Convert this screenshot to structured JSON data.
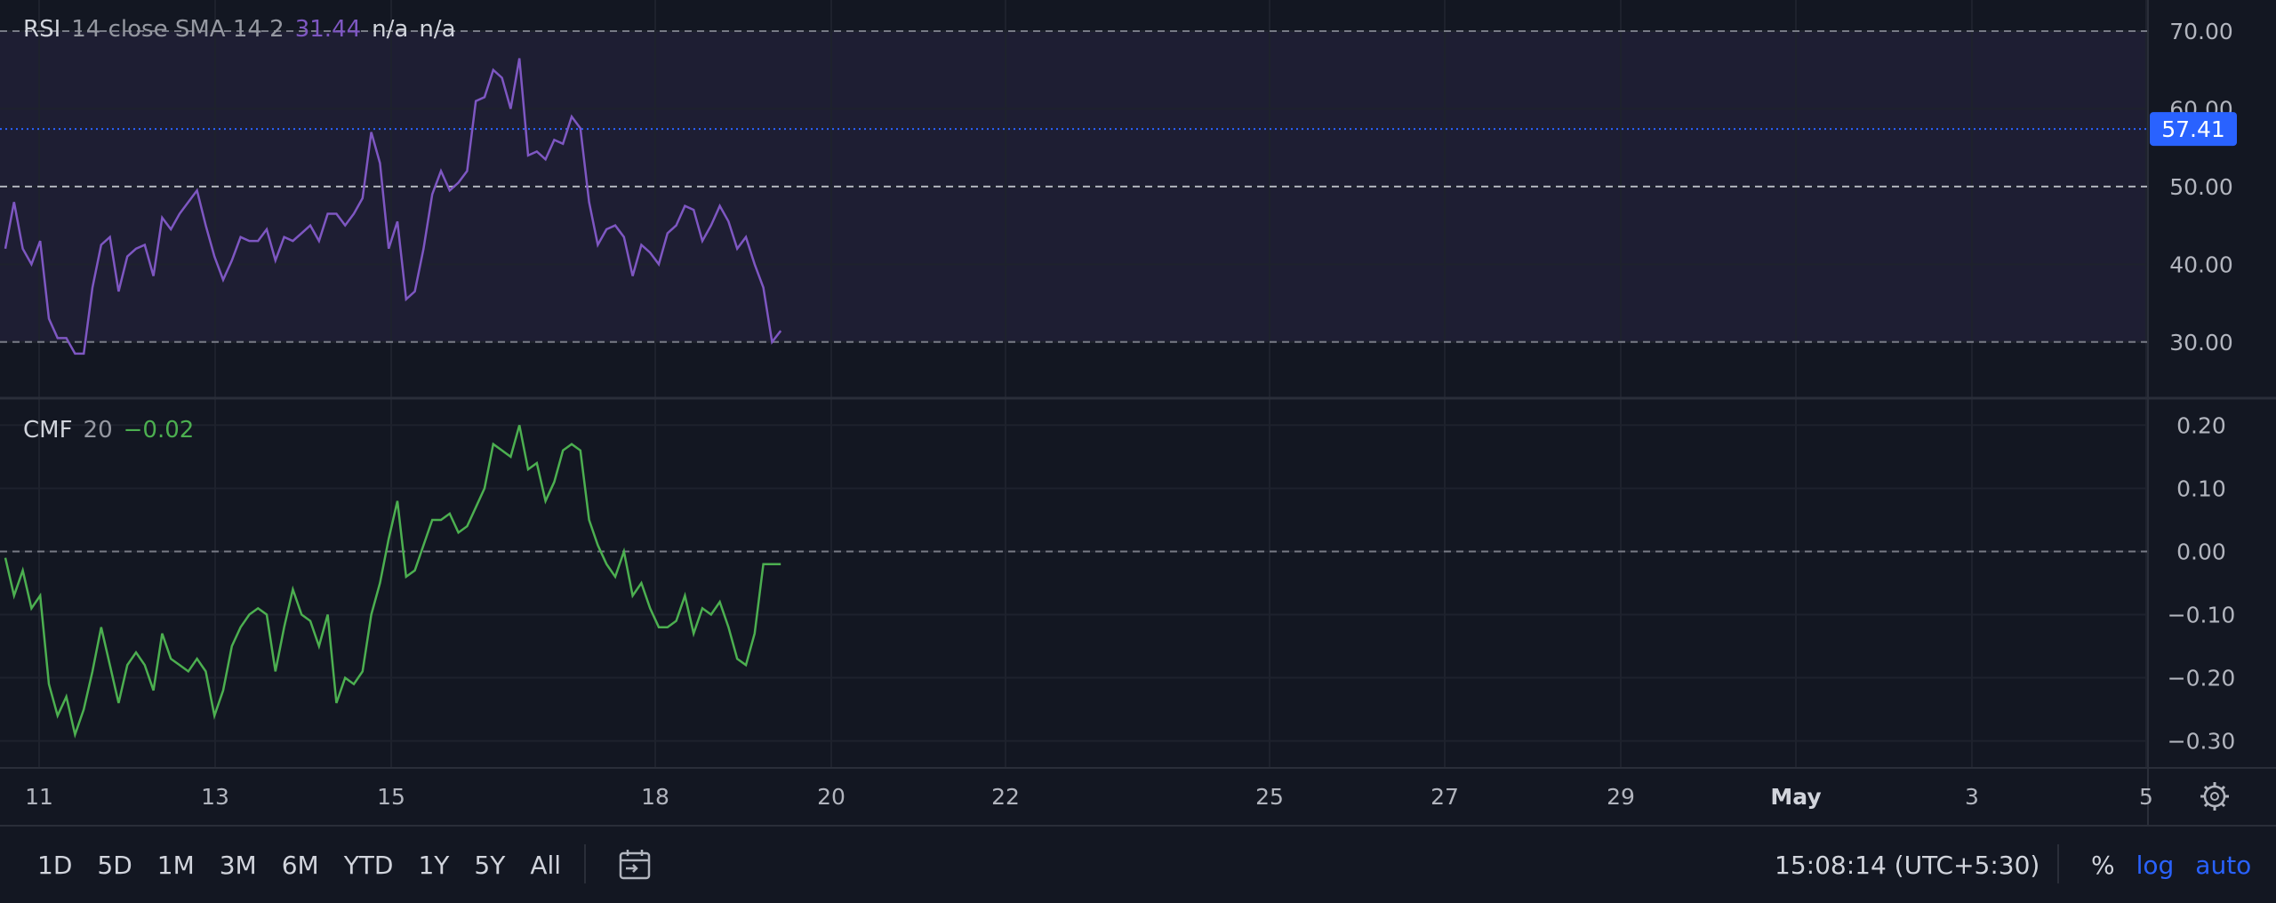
{
  "rsi_legend": {
    "name": "RSI",
    "params": "14 close SMA 14 2",
    "value": "31.44",
    "na1": "n/a",
    "na2": "n/a"
  },
  "cmf_legend": {
    "name": "CMF",
    "params": "20",
    "value": "−0.02"
  },
  "toolbar": {
    "ranges": [
      "1D",
      "5D",
      "1M",
      "3M",
      "6M",
      "YTD",
      "1Y",
      "5Y",
      "All"
    ],
    "time": "15:08:14 (UTC+5:30)",
    "percent": "%",
    "log": "log",
    "auto": "auto"
  },
  "colors": {
    "rsi_line": "#7e57c2",
    "cmf_line": "#4caf50",
    "price_badge": "#2962ff",
    "accent_text": "#2962ff"
  },
  "icons": [
    "calendar-range-icon",
    "settings-gear-icon"
  ],
  "chart_data": [
    {
      "type": "line",
      "name": "RSI",
      "x_ticks": [
        "11",
        "13",
        "15",
        "18",
        "20",
        "22",
        "25",
        "27",
        "29",
        "May",
        "3",
        "5"
      ],
      "y_ticks": [
        "70.00",
        "60.00",
        "50.00",
        "40.00",
        "30.00"
      ],
      "ylim": [
        23,
        74
      ],
      "bands": {
        "upper": 70,
        "middle": 50,
        "lower": 30
      },
      "crosshair_value": 57.41,
      "crosshair_label": "57.41",
      "x": [
        0,
        1,
        2,
        3,
        4,
        5,
        6,
        7,
        8,
        9,
        10,
        11,
        12,
        13,
        14,
        15,
        16,
        17,
        18,
        19,
        20,
        21,
        22,
        23,
        24,
        25,
        26,
        27,
        28,
        29,
        30,
        31,
        32,
        33,
        34,
        35,
        36,
        37,
        38,
        39,
        40,
        41,
        42,
        43,
        44,
        45,
        46,
        47,
        48,
        49,
        50,
        51,
        52,
        53,
        54,
        55,
        56,
        57,
        58,
        59,
        60,
        61,
        62,
        63,
        64,
        65,
        66,
        67,
        68,
        69,
        70,
        71,
        72,
        73,
        74,
        75,
        76,
        77,
        78,
        79,
        80,
        81,
        82,
        83,
        84,
        85,
        86,
        87,
        88,
        89,
        90,
        91,
        92,
        93,
        94,
        95,
        96,
        97,
        98,
        99,
        100,
        101,
        102,
        103,
        104,
        105,
        106,
        107,
        108,
        109,
        110,
        111,
        112,
        113,
        114,
        115,
        116,
        117,
        118,
        119,
        120,
        121,
        122,
        123,
        124,
        125,
        126,
        127,
        128,
        129,
        130,
        131,
        132,
        133,
        134,
        135,
        136,
        137,
        138,
        139,
        140,
        141,
        142,
        143,
        144,
        145,
        146,
        147,
        148
      ],
      "values": [
        42,
        48,
        42,
        40,
        43,
        33,
        30.5,
        30.5,
        28.5,
        28.5,
        37,
        42.5,
        43.5,
        36.5,
        41,
        42,
        42.5,
        38.5,
        46,
        44.5,
        46.5,
        48,
        49.5,
        45,
        41,
        38,
        40.5,
        43.5,
        43,
        43,
        44.5,
        40.5,
        43.5,
        43,
        44,
        45,
        43,
        46.5,
        46.5,
        45,
        46.5,
        48.5,
        57,
        53,
        42,
        45.5,
        35.5,
        36.5,
        42,
        49,
        52,
        49.5,
        50.5,
        52,
        61,
        61.5,
        65,
        64,
        60,
        66.5,
        54,
        54.5,
        53.5,
        56,
        55.5,
        59,
        57.5,
        48,
        42.5,
        44.5,
        45,
        43.5,
        38.5,
        42.5,
        41.5,
        40,
        44,
        45,
        47.5,
        47,
        43,
        45,
        47.5,
        45.5,
        42,
        43.5,
        40,
        37,
        30,
        31.44
      ]
    },
    {
      "type": "line",
      "name": "CMF",
      "y_ticks": [
        "0.20",
        "0.10",
        "0.00",
        "−0.10",
        "−0.20",
        "−0.30"
      ],
      "ylim": [
        -0.34,
        0.24
      ],
      "zero_line": 0,
      "values": [
        -0.01,
        -0.07,
        -0.03,
        -0.09,
        -0.07,
        -0.21,
        -0.26,
        -0.23,
        -0.29,
        -0.25,
        -0.19,
        -0.12,
        -0.18,
        -0.24,
        -0.18,
        -0.16,
        -0.18,
        -0.22,
        -0.13,
        -0.17,
        -0.18,
        -0.19,
        -0.17,
        -0.19,
        -0.26,
        -0.22,
        -0.15,
        -0.12,
        -0.1,
        -0.09,
        -0.1,
        -0.19,
        -0.12,
        -0.06,
        -0.1,
        -0.11,
        -0.15,
        -0.1,
        -0.24,
        -0.2,
        -0.21,
        -0.19,
        -0.1,
        -0.05,
        0.02,
        0.08,
        -0.04,
        -0.03,
        0.01,
        0.05,
        0.05,
        0.06,
        0.03,
        0.04,
        0.07,
        0.1,
        0.17,
        0.16,
        0.15,
        0.2,
        0.13,
        0.14,
        0.08,
        0.11,
        0.16,
        0.17,
        0.16,
        0.05,
        0.01,
        -0.02,
        -0.04,
        0,
        -0.07,
        -0.05,
        -0.09,
        -0.12,
        -0.12,
        -0.11,
        -0.07,
        -0.13,
        -0.09,
        -0.1,
        -0.08,
        -0.12,
        -0.17,
        -0.18,
        -0.13,
        -0.02,
        -0.02,
        -0.02
      ]
    }
  ]
}
